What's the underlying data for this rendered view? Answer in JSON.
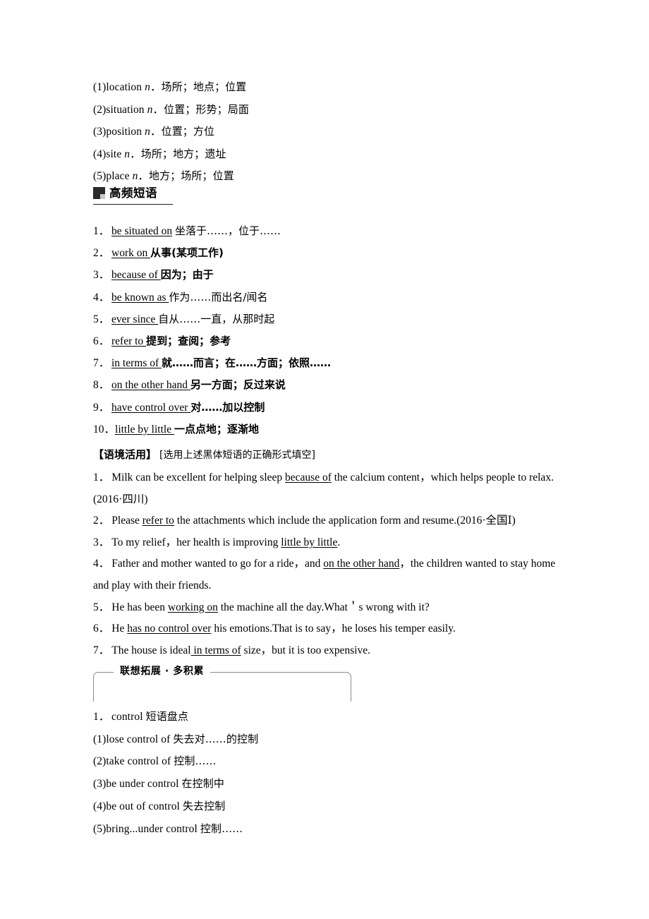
{
  "senses": {
    "items": [
      {
        "marker": "(1)",
        "word": "location",
        "pos": "n",
        "gloss": "场所；地点；位置"
      },
      {
        "marker": "(2)",
        "word": "situation",
        "pos": "n",
        "gloss": "位置；形势；局面"
      },
      {
        "marker": "(3)",
        "word": "position",
        "pos": "n",
        "gloss": "位置；方位"
      },
      {
        "marker": "(4)",
        "word": "site",
        "pos": "n",
        "gloss": "场所；地方；遗址"
      },
      {
        "marker": "(5)",
        "word": "place",
        "pos": "n",
        "gloss": "地方；场所；位置"
      }
    ]
  },
  "section": {
    "icon": "block-square-icon",
    "title": "高频短语"
  },
  "phrases": {
    "items": [
      {
        "num": "1．",
        "en": "be situated on",
        "cn": "坐落于……，位于……",
        "bold": false
      },
      {
        "num": "2．",
        "en": "work on ",
        "cn": "从事(某项工作)",
        "bold": true
      },
      {
        "num": "3．",
        "en": "because of ",
        "cn": "因为；由于",
        "bold": true
      },
      {
        "num": "4．",
        "en": "be known as ",
        "cn": "作为……而出名/闻名",
        "bold": false
      },
      {
        "num": "5．",
        "en": "ever since ",
        "cn": "自从……一直，从那时起",
        "bold": false
      },
      {
        "num": "6．",
        "en": "refer to ",
        "cn": "提到；查阅；参考",
        "bold": true
      },
      {
        "num": "7．",
        "en": "in terms of ",
        "cn": "就……而言；在……方面；依照……",
        "bold": true
      },
      {
        "num": "8．",
        "en": "on the other hand ",
        "cn": "另一方面；反过来说",
        "bold": true
      },
      {
        "num": "9．",
        "en": "have control over ",
        "cn": "对……加以控制",
        "bold": true
      },
      {
        "num": "10．",
        "en": "little by little ",
        "cn": "一点点地；逐渐地",
        "bold": true
      }
    ]
  },
  "directive": {
    "lead": "【语境活用】",
    "body": "[选用上述黑体短语的正确形式填空]"
  },
  "exercises": {
    "items": [
      {
        "num": "1．",
        "parts": [
          {
            "t": "Milk can be excellent for helping sleep ",
            "u": false
          },
          {
            "t": "because of",
            "u": true
          },
          {
            "t": " the calcium content，which helps people to relax.(2016·四川)",
            "u": false
          }
        ]
      },
      {
        "num": "2．",
        "parts": [
          {
            "t": "Please ",
            "u": false
          },
          {
            "t": "refer to",
            "u": true
          },
          {
            "t": " the attachments which include the application form and resume.(2016·全国Ⅰ)",
            "u": false
          }
        ]
      },
      {
        "num": "3．",
        "parts": [
          {
            "t": "To my relief，her health is improving ",
            "u": false
          },
          {
            "t": "little by little",
            "u": true
          },
          {
            "t": ".",
            "u": false
          }
        ]
      },
      {
        "num": "4．",
        "parts": [
          {
            "t": "Father and mother wanted to go for a ride，and ",
            "u": false
          },
          {
            "t": "on the other hand",
            "u": true
          },
          {
            "t": "，the children wanted to stay home and play with their friends.",
            "u": false
          }
        ]
      },
      {
        "num": "5．",
        "parts": [
          {
            "t": "He has been ",
            "u": false
          },
          {
            "t": "working on",
            "u": true
          },
          {
            "t": " the machine all the day.What＇s wrong with it?",
            "u": false
          }
        ]
      },
      {
        "num": "6．",
        "parts": [
          {
            "t": "He ",
            "u": false
          },
          {
            "t": "has no control over",
            "u": true
          },
          {
            "t": " his emotions.That is to say，he loses his temper easily.",
            "u": false
          }
        ]
      },
      {
        "num": "7．",
        "parts": [
          {
            "t": "The house is ideal",
            "u": false
          },
          {
            "t": " in terms of",
            "u": true
          },
          {
            "t": " size，but it is too expensive.",
            "u": false
          }
        ]
      }
    ]
  },
  "assoc": {
    "label": "联想拓展 · 多积累",
    "heading_num": "1．",
    "heading_en": "control ",
    "heading_cn": "短语盘点",
    "items": [
      {
        "marker": "(1)",
        "en": "lose control of ",
        "cn": "失去对……的控制"
      },
      {
        "marker": "(2)",
        "en": "take control of ",
        "cn": "控制……"
      },
      {
        "marker": "(3)",
        "en": "be under control ",
        "cn": "在控制中"
      },
      {
        "marker": "(4)",
        "en": "be out of control ",
        "cn": "失去控制"
      },
      {
        "marker": "(5)",
        "en": "bring...under control  ",
        "cn": "控制……"
      }
    ]
  }
}
